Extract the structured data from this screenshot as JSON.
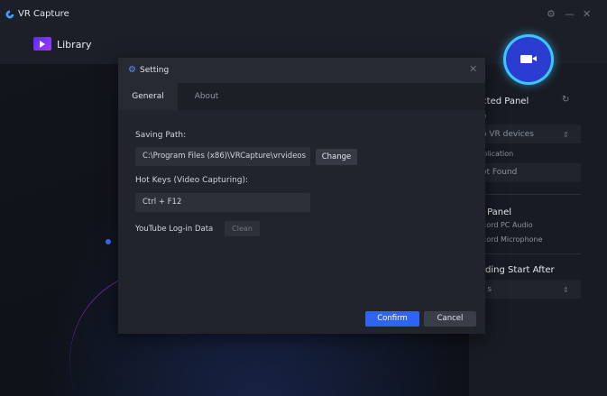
{
  "window": {
    "title": "VR Capture",
    "controls": {
      "settings_icon": "gear-icon",
      "minimize_glyph": "—",
      "close_glyph": "✕"
    }
  },
  "nav": {
    "library_label": "Library"
  },
  "right_panel": {
    "selected_panel_heading": "ected Panel",
    "device_label": "ce",
    "device_select_value": "o VR devices",
    "application_label": "pplication",
    "application_value": "ot Found",
    "audio_heading": "io Panel",
    "record_pc_audio": "ecord PC Audio",
    "record_microphone": "ecord Microphone",
    "recording_start_heading": "ording Start After",
    "recording_start_value": ") s",
    "caret_glyph": "⇕",
    "refresh_glyph": "↻"
  },
  "dialog": {
    "title": "Setting",
    "close_glyph": "✕",
    "tabs": [
      {
        "label": "General",
        "active": true
      },
      {
        "label": "About",
        "active": false
      }
    ],
    "saving_path_label": "Saving Path:",
    "saving_path_value": "C:\\Program Files (x86)\\VRCapture\\vrvideos",
    "change_button": "Change",
    "hotkeys_label": "Hot Keys (Video Capturing):",
    "hotkeys_value": "Ctrl + F12",
    "youtube_label": "YouTube Log-in Data",
    "clean_button": "Clean",
    "confirm_button": "Confirm",
    "cancel_button": "Cancel"
  },
  "colors": {
    "accent_blue": "#2f63f2",
    "record_ring": "#3ec6ff",
    "library_icon": "#7a33ff"
  }
}
